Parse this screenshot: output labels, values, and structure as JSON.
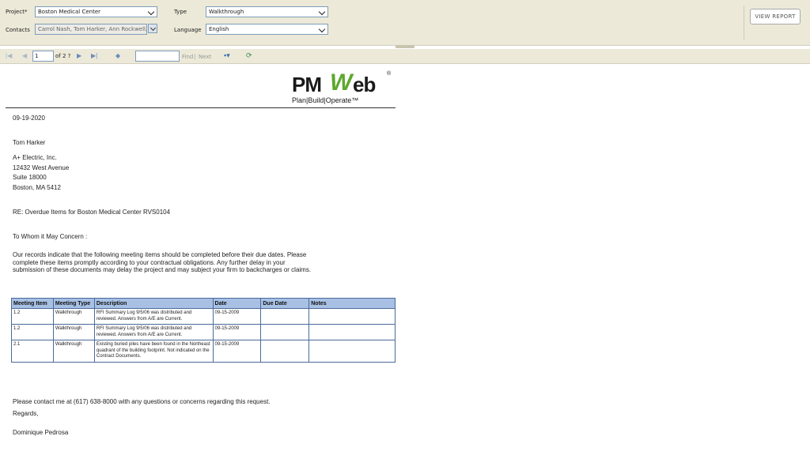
{
  "params": {
    "project_label": "Project*",
    "project_value": "Boston Medical Center",
    "type_label": "Type",
    "type_value": "Walkthrough",
    "contacts_label": "Contacts",
    "contacts_value": "Carrol Nash, Tom Harker, Ann Rockwell,",
    "language_label": "Language",
    "language_value": "English",
    "view_report_label": "VIEW REPORT"
  },
  "toolbar": {
    "page_value": "1",
    "of_pages": "of 2 ?",
    "find_label": "Find",
    "separator": "|",
    "next_label": "Next",
    "find_value": ""
  },
  "report": {
    "logo": {
      "pm": "PM",
      "w": "W",
      "eb": "eb",
      "reg": "®",
      "tagline": "Plan|Build|Operate™"
    },
    "date": "09-19-2020",
    "recipient": "Tom Harker",
    "address": [
      "A+ Electric, Inc.",
      "12432 West Avenue",
      "Suite 18000",
      "Boston, MA  5412"
    ],
    "re_line": "RE: Overdue Items for  Boston Medical Center  RVS0104",
    "salutation": "To Whom it May Concern :",
    "body": "Our records indicate that the following meeting items should be completed before their due dates. Please complete these items promptly according to your contractual obligations. Any further delay in your submission of these documents may delay the project and may subject your firm to backcharges or claims.",
    "table": {
      "headers": [
        "Meeting Item",
        "Meeting Type",
        "Description",
        "Date",
        "Due Date",
        "Notes"
      ],
      "rows": [
        [
          "1.2",
          "Walkthrough",
          "RFI Summary Log 9/5/06 was distributed and reviewed. Answers from A/E are Current.",
          "09-15-2009",
          "",
          ""
        ],
        [
          "1.2",
          "Walkthrough",
          "RFI Summary Log 9/5/06 was distributed and reviewed. Answers from A/E are Current.",
          "09-15-2009",
          "",
          ""
        ],
        [
          "2.1",
          "Walkthrough",
          "Existing buried piles have been found in the Northeast quadrant of the building footprint. Not indicated on the Contract Documents.",
          "09-15-2009",
          "",
          ""
        ]
      ]
    },
    "contact_line": "Please contact me at (617) 638-8000  with any questions or concerns regarding this request.",
    "regards": "Regards,",
    "signature": "Dominique Pedrosa"
  }
}
